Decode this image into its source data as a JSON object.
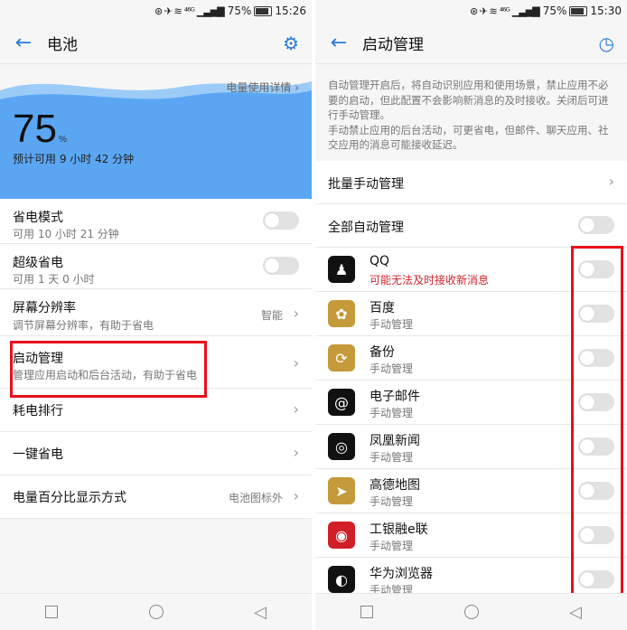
{
  "left": {
    "status": {
      "signal_text": "⁴⁶ᴳ",
      "battery": "75%",
      "time": "15:26"
    },
    "title": "电池",
    "usage_detail": "电量使用详情",
    "battery_percent": "75",
    "percent_unit": "%",
    "remaining": "预计可用 9 小时 42 分钟",
    "items": [
      {
        "title": "省电模式",
        "sub": "可用 10 小时 21 分钟",
        "control": "toggle"
      },
      {
        "title": "超级省电",
        "sub": "可用 1 天 0 小时",
        "control": "toggle"
      },
      {
        "title": "屏幕分辨率",
        "sub": "调节屏幕分辨率，有助于省电",
        "value": "智能",
        "control": "chevron"
      },
      {
        "title": "启动管理",
        "sub": "管理应用启动和后台活动，有助于省电",
        "control": "chevron"
      },
      {
        "title": "耗电排行",
        "control": "chevron"
      },
      {
        "title": "一键省电",
        "control": "chevron"
      },
      {
        "title": "电量百分比显示方式",
        "value": "电池图标外",
        "control": "chevron"
      }
    ]
  },
  "right": {
    "status": {
      "signal_text": "⁴⁶ᴳ",
      "battery": "75%",
      "time": "15:30"
    },
    "title": "启动管理",
    "description": "自动管理开启后，将自动识别应用和使用场景，禁止应用不必要的启动，但此配置不会影响新消息的及时接收。关闭后可进行手动管理。\n手动禁止应用的后台活动，可更省电，但邮件、聊天应用、社交应用的消息可能接收延迟。",
    "batch_manual": "批量手动管理",
    "all_auto": "全部自动管理",
    "apps": [
      {
        "name": "QQ",
        "sub": "可能无法及时接收新消息",
        "icon": "qq-icon",
        "color": "#111111"
      },
      {
        "name": "百度",
        "sub": "手动管理",
        "icon": "baidu-icon",
        "color": "#c59a3a"
      },
      {
        "name": "备份",
        "sub": "手动管理",
        "icon": "backup-icon",
        "color": "#c59a3a"
      },
      {
        "name": "电子邮件",
        "sub": "手动管理",
        "icon": "email-icon",
        "color": "#111111"
      },
      {
        "name": "凤凰新闻",
        "sub": "手动管理",
        "icon": "ifeng-news-icon",
        "color": "#111111"
      },
      {
        "name": "高德地图",
        "sub": "手动管理",
        "icon": "amap-icon",
        "color": "#c59a3a"
      },
      {
        "name": "工银融e联",
        "sub": "手动管理",
        "icon": "icbc-icon",
        "color": "#d01f27"
      },
      {
        "name": "华为浏览器",
        "sub": "手动管理",
        "icon": "browser-icon",
        "color": "#111111"
      }
    ]
  },
  "colors": {
    "accent": "#2a7bd8",
    "highlight": "#e8101a",
    "warning": "#d1242b",
    "wave": "#5aa6f2"
  }
}
